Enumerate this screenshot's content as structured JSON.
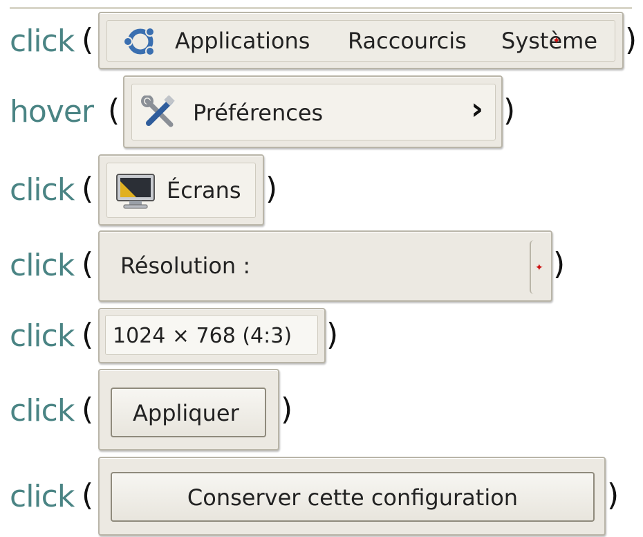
{
  "steps": [
    {
      "verb": "click",
      "items": [
        "Applications",
        "Raccourcis",
        "Système"
      ]
    },
    {
      "verb": "hover",
      "label": "Préférences",
      "arrow": "›"
    },
    {
      "verb": "click",
      "label": "Écrans"
    },
    {
      "verb": "click",
      "label": "Résolution :"
    },
    {
      "verb": "click",
      "label": "1024 × 768 (4:3)"
    },
    {
      "verb": "click",
      "label": "Appliquer"
    },
    {
      "verb": "click",
      "label": "Conserver cette configuration"
    }
  ],
  "icons": {
    "step1": "ubuntu-logo-icon",
    "step2": "preferences-tools-icon",
    "step3": "monitor-screens-icon",
    "step4": "combo-arrow-icon"
  },
  "colors": {
    "verb": "#4a8484",
    "panel": "#ece9e2",
    "accent_red": "#cc1111"
  }
}
